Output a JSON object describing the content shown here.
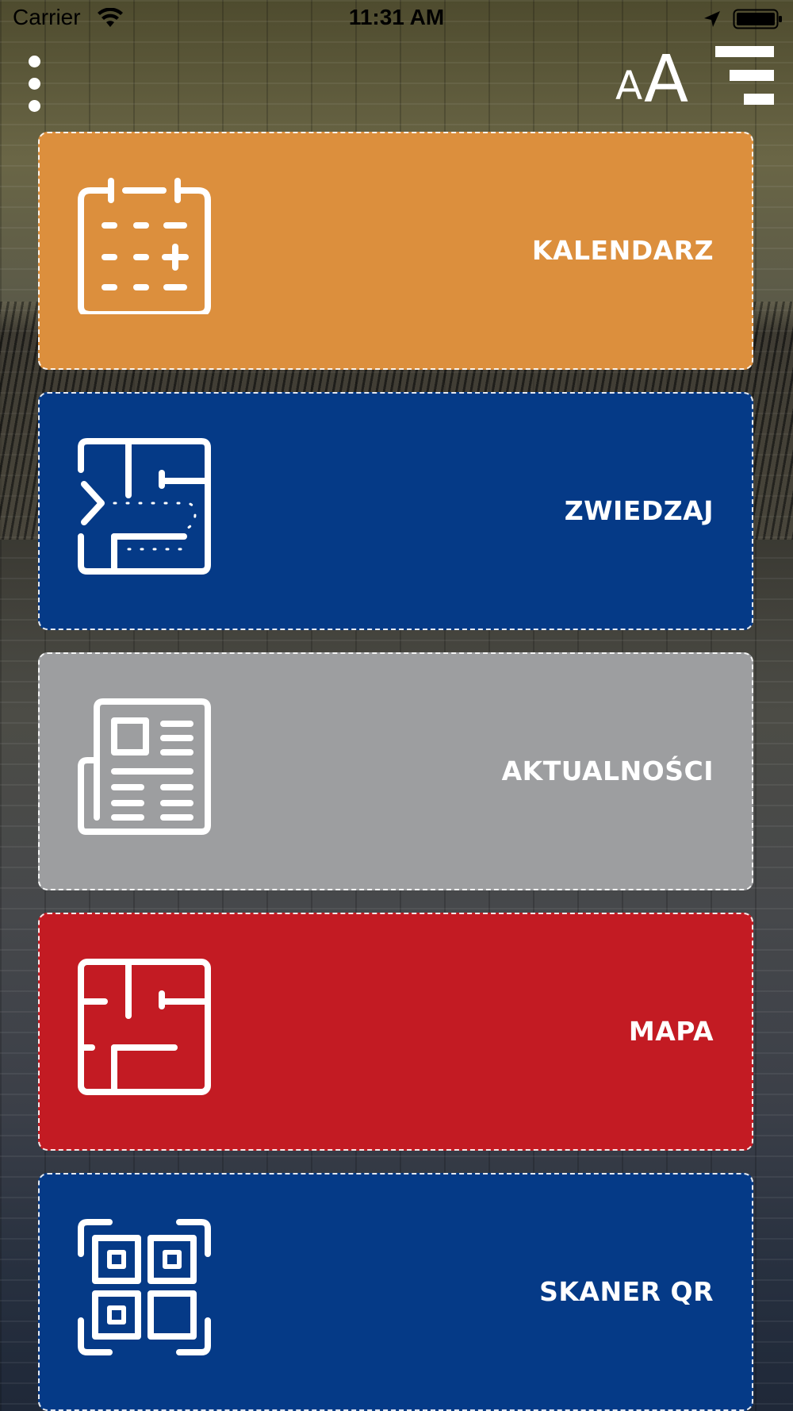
{
  "status_bar": {
    "carrier": "Carrier",
    "time": "11:31 AM",
    "icons": [
      "wifi-icon",
      "location-arrow-icon",
      "battery-icon"
    ]
  },
  "toolbar": {
    "more_icon": "vertical-dots-icon",
    "font_size_small": "A",
    "font_size_large": "A",
    "menu_icon": "hamburger-menu-icon"
  },
  "tiles": [
    {
      "label": "KALENDARZ",
      "icon": "calendar-add-icon",
      "color": "#dc8f3d"
    },
    {
      "label": "ZWIEDZAJ",
      "icon": "tour-route-icon",
      "color": "#053a87"
    },
    {
      "label": "AKTUALNOŚCI",
      "icon": "newspaper-icon",
      "color": "#9d9ea0"
    },
    {
      "label": "MAPA",
      "icon": "floor-plan-icon",
      "color": "#c31b23"
    },
    {
      "label": "SKANER QR",
      "icon": "qr-code-icon",
      "color": "#053a87"
    }
  ]
}
